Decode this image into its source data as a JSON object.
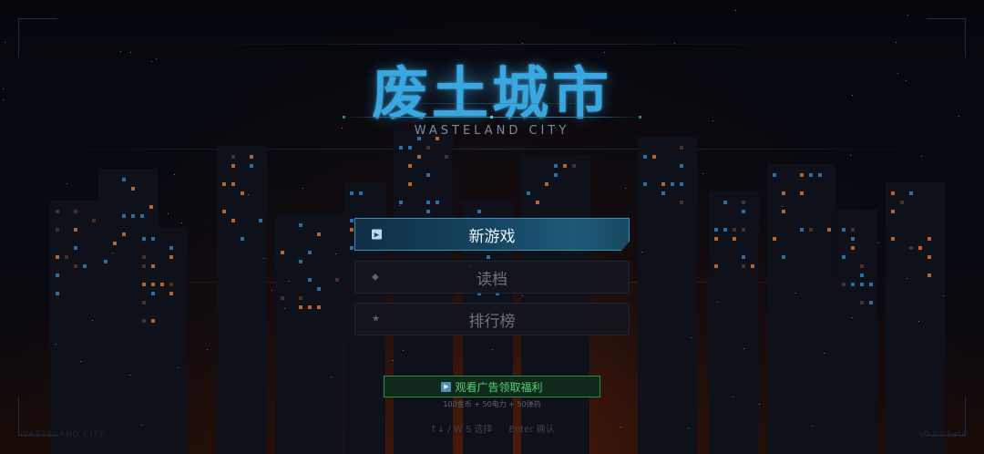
{
  "title": {
    "main": "废土城市",
    "subtitle": "WASTELAND CITY"
  },
  "menu": {
    "new_game": "新游戏",
    "load_game": "读档",
    "leaderboard": "排行榜"
  },
  "icons": {
    "new_game": "play-icon",
    "load_game": "diamond-icon",
    "leaderboard": "star-icon"
  },
  "ad": {
    "label": "观看广告领取福利",
    "reward": "100金币 + 50电力 + 50弹药"
  },
  "hints": {
    "navigate": "↑↓ / W S  选择",
    "confirm": "Enter  确认"
  },
  "footer": {
    "left": "WASTELAND CITY",
    "right": "v0.3.0 beta"
  },
  "colors": {
    "title": "#3aa8e0",
    "primary_button": "#154563",
    "ad_border": "#2f8a48",
    "ad_text": "#55d37a"
  }
}
